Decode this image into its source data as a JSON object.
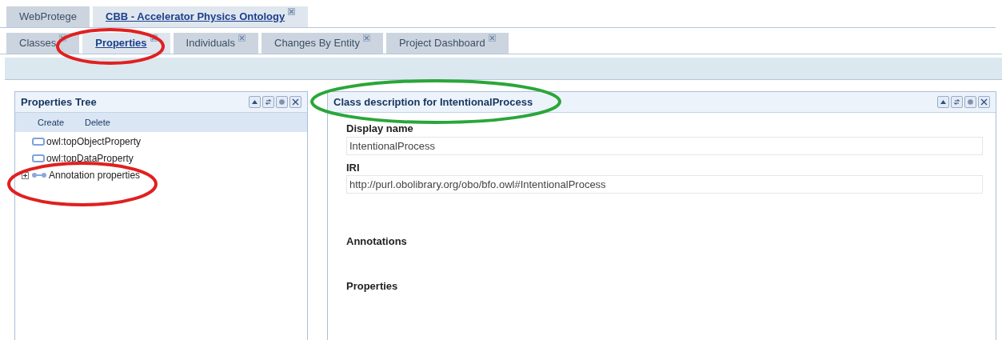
{
  "top_tabs": [
    {
      "label": "WebProtege",
      "selected": false,
      "closable": false
    },
    {
      "label": "CBB - Accelerator Physics Ontology",
      "selected": true,
      "closable": true
    }
  ],
  "sub_tabs": [
    {
      "label": "Classes",
      "selected": false,
      "closable": true
    },
    {
      "label": "Properties",
      "selected": true,
      "closable": true
    },
    {
      "label": "Individuals",
      "selected": false,
      "closable": true
    },
    {
      "label": "Changes By Entity",
      "selected": false,
      "closable": true
    },
    {
      "label": "Project Dashboard",
      "selected": false,
      "closable": true
    }
  ],
  "properties_tree": {
    "title": "Properties Tree",
    "toolbar": [
      "Create",
      "Delete"
    ],
    "items": [
      {
        "label": "owl:topObjectProperty",
        "kind": "object",
        "expandable": false
      },
      {
        "label": "owl:topDataProperty",
        "kind": "data",
        "expandable": false
      },
      {
        "label": "Annotation properties",
        "kind": "annotation",
        "expandable": true
      }
    ]
  },
  "class_panel": {
    "title": "Class description for IntentionalProcess",
    "fields": [
      {
        "label": "Display name",
        "value": "IntentionalProcess"
      },
      {
        "label": "IRI",
        "value": "http://purl.obolibrary.org/obo/bfo.owl#IntentionalProcess"
      }
    ],
    "sections": [
      "Annotations",
      "Properties"
    ]
  }
}
